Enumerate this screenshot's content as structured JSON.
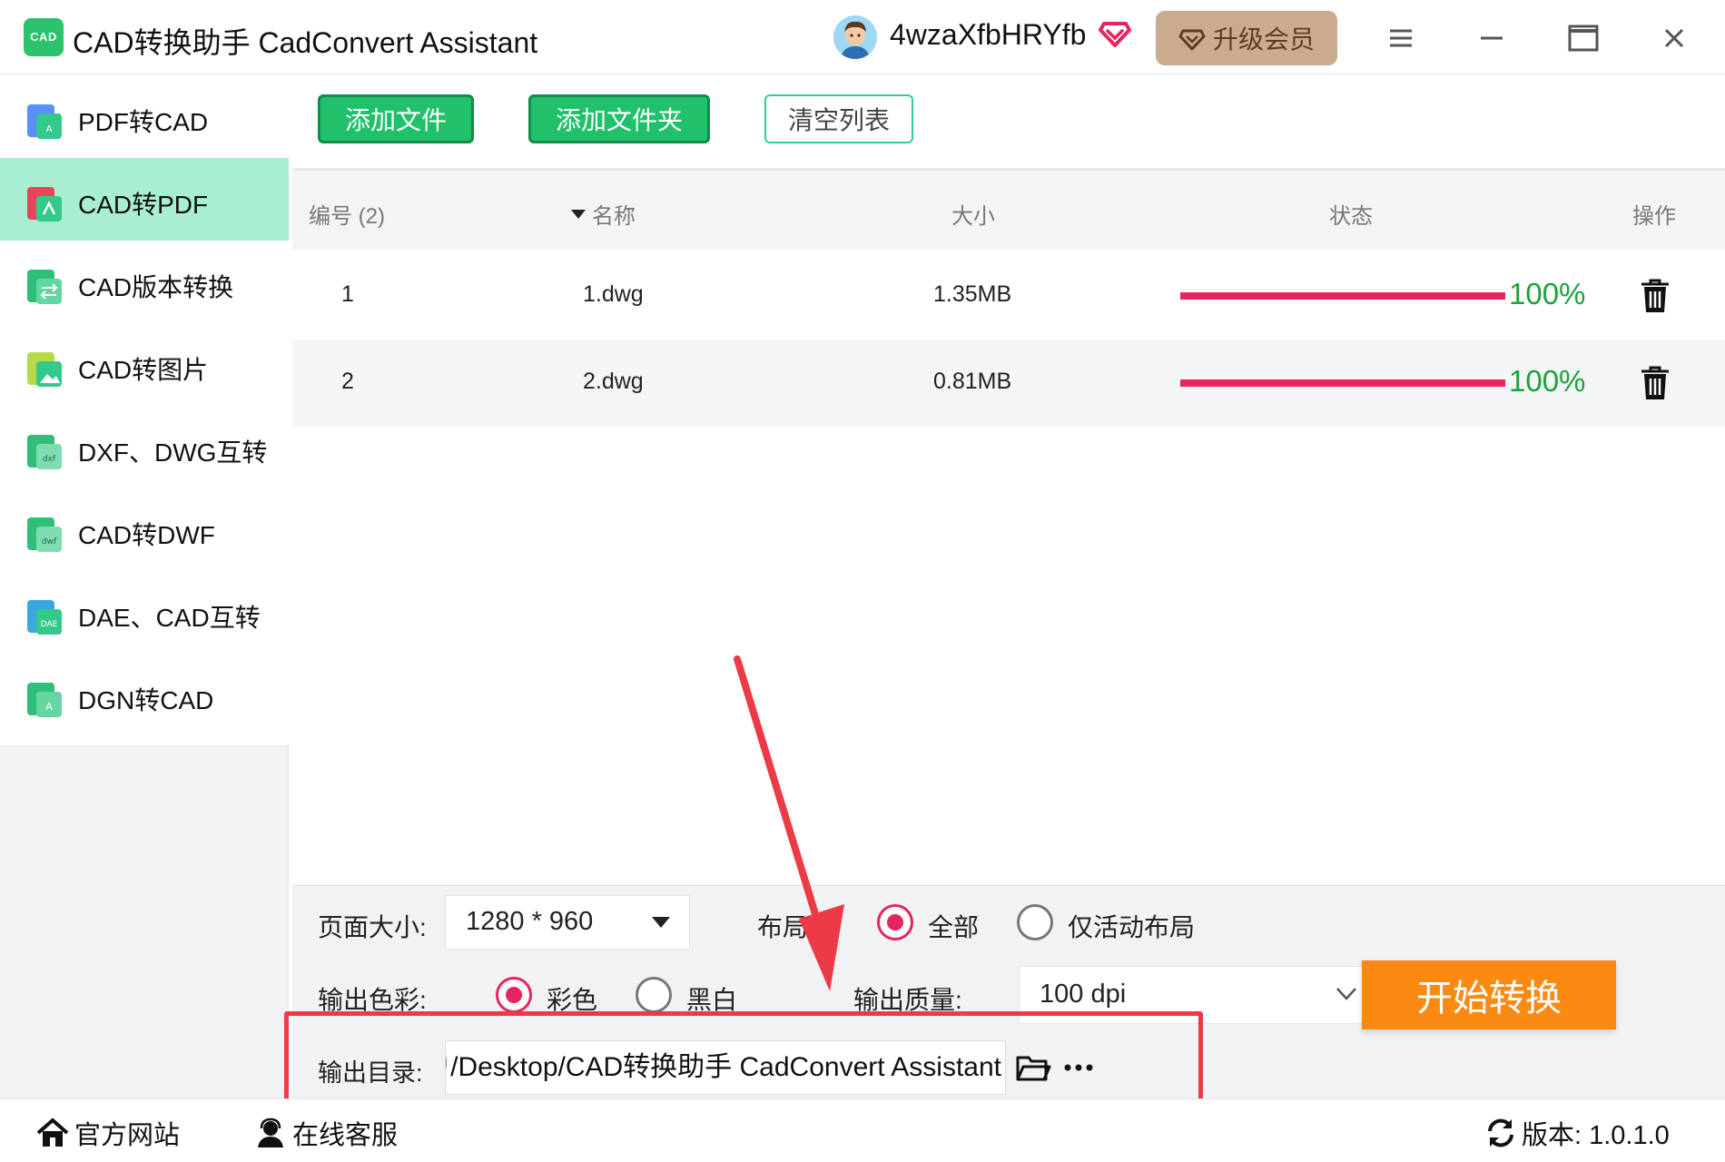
{
  "app": {
    "logo_text": "CAD",
    "title": "CAD转换助手 CadConvert Assistant",
    "username": "4wzaXfbHRYfb",
    "upgrade_label": "升级会员",
    "brand_color": "#21c16b"
  },
  "sidebar": {
    "items": [
      {
        "label": "PDF转CAD",
        "icon": "pdf-to-cad-icon",
        "active": false
      },
      {
        "label": "CAD转PDF",
        "icon": "cad-to-pdf-icon",
        "active": true
      },
      {
        "label": "CAD版本转换",
        "icon": "cad-version-icon",
        "active": false
      },
      {
        "label": "CAD转图片",
        "icon": "cad-to-image-icon",
        "active": false
      },
      {
        "label": "DXF、DWG互转",
        "icon": "dxf-dwg-icon",
        "active": false
      },
      {
        "label": "CAD转DWF",
        "icon": "cad-to-dwf-icon",
        "active": false
      },
      {
        "label": "DAE、CAD互转",
        "icon": "dae-cad-icon",
        "active": false
      },
      {
        "label": "DGN转CAD",
        "icon": "dgn-to-cad-icon",
        "active": false
      }
    ]
  },
  "toolbar": {
    "add_file": "添加文件",
    "add_folder": "添加文件夹",
    "clear_list": "清空列表"
  },
  "table": {
    "headers": {
      "index": "编号 (2)",
      "name": "名称",
      "size": "大小",
      "status": "状态",
      "action": "操作"
    },
    "rows": [
      {
        "index": "1",
        "name": "1.dwg",
        "size": "1.35MB",
        "progress": 1.0,
        "percent": "100%"
      },
      {
        "index": "2",
        "name": "2.dwg",
        "size": "0.81MB",
        "progress": 1.0,
        "percent": "100%"
      }
    ]
  },
  "settings": {
    "page_size_label": "页面大小:",
    "page_size_value": "1280 * 960",
    "layout_label": "布局:",
    "layout_options": [
      "全部",
      "仅活动布局"
    ],
    "layout_selected": "全部",
    "color_label": "输出色彩:",
    "color_options": [
      "彩色",
      "黑白"
    ],
    "color_selected": "彩色",
    "quality_label": "输出质量:",
    "quality_value": "100 dpi",
    "start_label": "开始转换",
    "outdir_label": "输出目录:",
    "outdir_value": "C:/Users/用户/Desktop/CAD转换助手 CadConvert Assistant"
  },
  "footer": {
    "website": "官方网站",
    "support": "在线客服",
    "version": "版本: 1.0.1.0"
  },
  "colors": {
    "progress": "#e8245f",
    "percent": "#1ba33b",
    "start_button": "#fa8a12",
    "highlight": "#ec3a47",
    "active_sidebar": "#a8eed0"
  }
}
